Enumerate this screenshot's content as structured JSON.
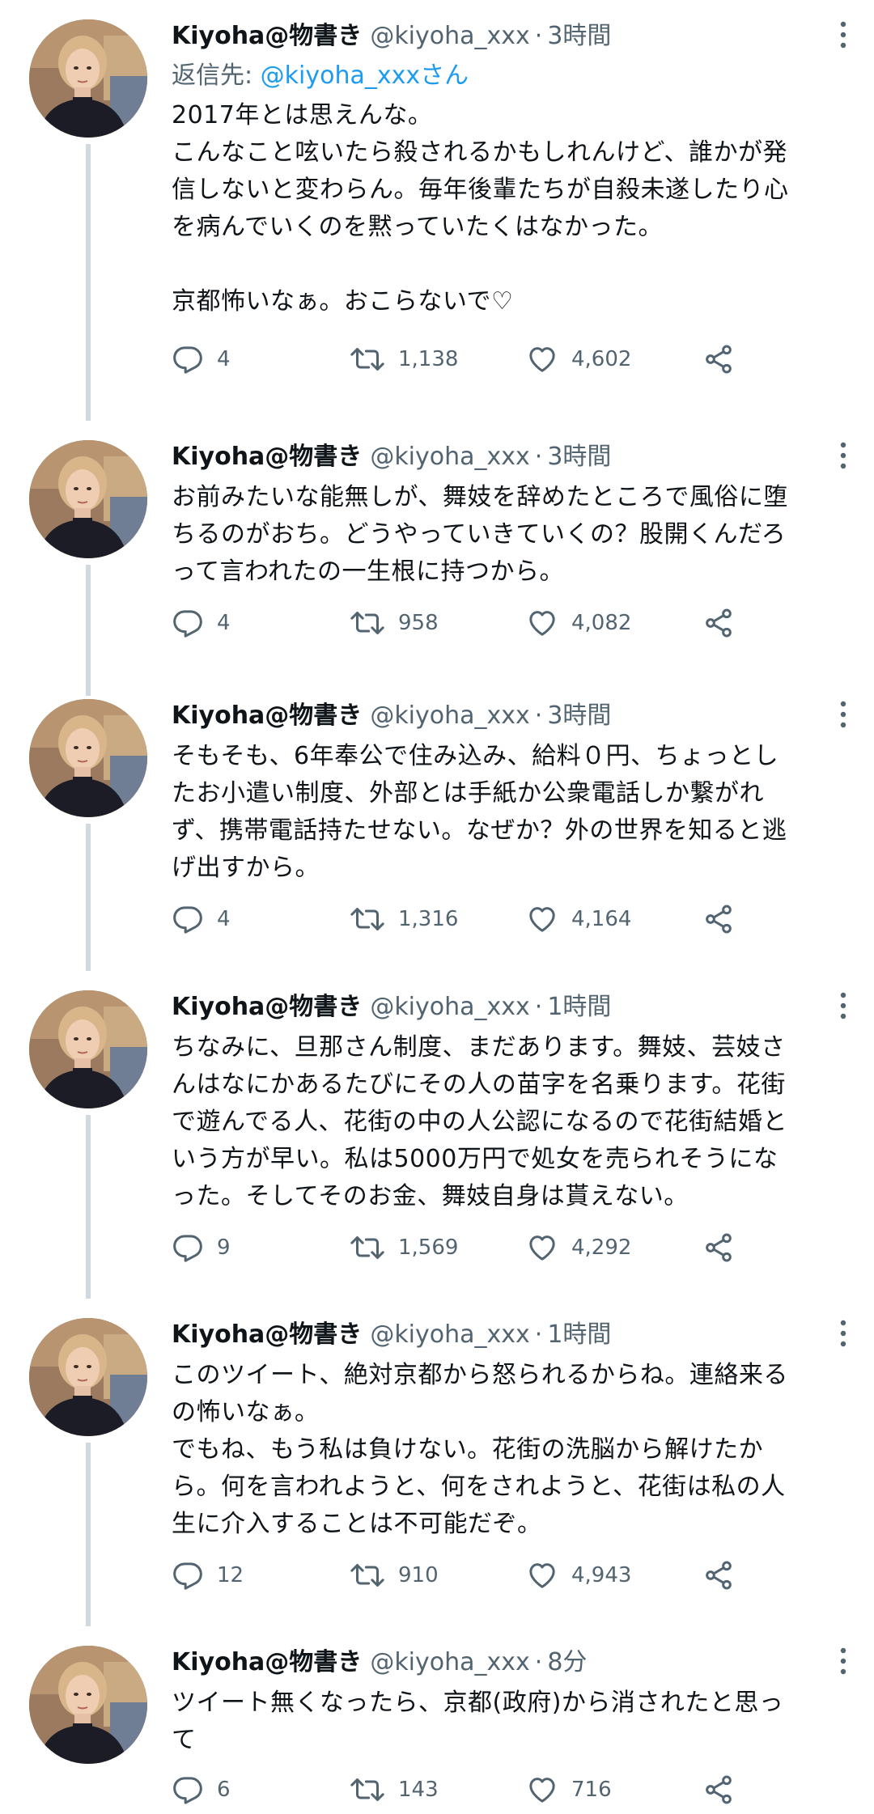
{
  "reply_to": {
    "prefix": "返信先: ",
    "mention": "@kiyoha_xxxさん"
  },
  "tweets": [
    {
      "name": "Kiyoha@物書き",
      "handle": "@kiyoha_xxx",
      "separator": "·",
      "time": "3時間",
      "text": "2017年とは思えんな。\nこんなこと呟いたら殺されるかもしれんけど、誰かが発\n信しないと変わらん。毎年後輩たちが自殺未遂したり心\nを病んでいくのを黙っていたくはなかった。\n\n京都怖いなぁ。おこらないで♡",
      "replies": "4",
      "retweets": "1,138",
      "likes": "4,602"
    },
    {
      "name": "Kiyoha@物書き",
      "handle": "@kiyoha_xxx",
      "separator": "·",
      "time": "3時間",
      "text": "お前みたいな能無しが、舞妓を辞めたところで風俗に堕\nちるのがおち。どうやっていきていくの？股開くんだろ\nって言われたの一生根に持つから。",
      "replies": "4",
      "retweets": "958",
      "likes": "4,082"
    },
    {
      "name": "Kiyoha@物書き",
      "handle": "@kiyoha_xxx",
      "separator": "·",
      "time": "3時間",
      "text": "そもそも、6年奉公で住み込み、給料０円、ちょっとし\nたお小遣い制度、外部とは手紙か公衆電話しか繋がれ\nず、携帯電話持たせない。なぜか？外の世界を知ると逃\nげ出すから。",
      "replies": "4",
      "retweets": "1,316",
      "likes": "4,164"
    },
    {
      "name": "Kiyoha@物書き",
      "handle": "@kiyoha_xxx",
      "separator": "·",
      "time": "1時間",
      "text": "ちなみに、旦那さん制度、まだあります。舞妓、芸妓さ\nんはなにかあるたびにその人の苗字を名乗ります。花街\nで遊んでる人、花街の中の人公認になるので花街結婚と\nいう方が早い。私は5000万円で処女を売られそうにな\nった。そしてそのお金、舞妓自身は貰えない。",
      "replies": "9",
      "retweets": "1,569",
      "likes": "4,292"
    },
    {
      "name": "Kiyoha@物書き",
      "handle": "@kiyoha_xxx",
      "separator": "·",
      "time": "1時間",
      "text": "このツイート、絶対京都から怒られるからね。連絡来る\nの怖いなぁ。\nでもね、もう私は負けない。花街の洗脳から解けたか\nら。何を言われようと、何をされようと、花街は私の人\n生に介入することは不可能だぞ。",
      "replies": "12",
      "retweets": "910",
      "likes": "4,943"
    },
    {
      "name": "Kiyoha@物書き",
      "handle": "@kiyoha_xxx",
      "separator": "·",
      "time": "8分",
      "text": "ツイート無くなったら、京都(政府)から消されたと思っ\nて",
      "replies": "6",
      "retweets": "143",
      "likes": "716"
    }
  ]
}
